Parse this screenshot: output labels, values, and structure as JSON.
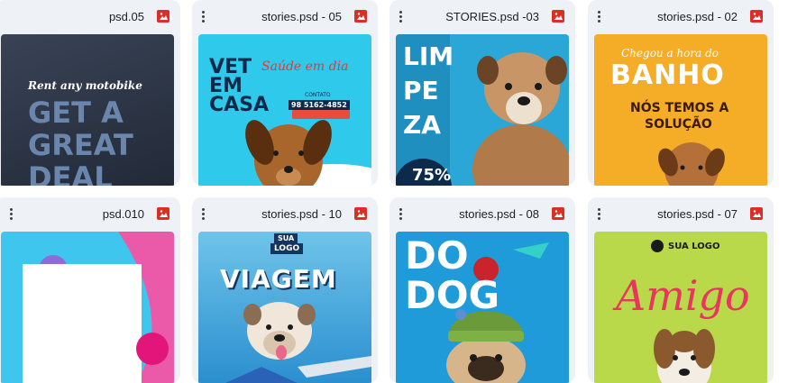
{
  "grid": {
    "rows": [
      [
        {
          "file_name": "psd.05",
          "thumb": {
            "line1": "Rent any motobike",
            "line2": "GET A",
            "line3": "GREAT",
            "line4": "DEAL"
          }
        },
        {
          "file_name": "stories.psd - 05",
          "thumb": {
            "line1": "VET",
            "line2": "EM",
            "line3": "CASA",
            "script": "Saúde em dia",
            "contact": "CONTATO",
            "phone": "98 5162-4852"
          }
        },
        {
          "file_name": "STORIES.psd -03",
          "thumb": {
            "line1": "LIM",
            "line2": "PE",
            "line3": "ZA",
            "badge": "75%"
          }
        },
        {
          "file_name": "stories.psd - 02",
          "thumb": {
            "script": "Chegou a hora do",
            "title": "BANHO",
            "line1": "NÓS TEMOS A",
            "line2": "SOLUÇÃO"
          }
        }
      ],
      [
        {
          "file_name": "psd.010",
          "thumb": {}
        },
        {
          "file_name": "stories.psd - 10",
          "thumb": {
            "logo_line1": "SUA",
            "logo_line2": "LOGO",
            "title": "VIAGEM"
          }
        },
        {
          "file_name": "stories.psd - 08",
          "thumb": {
            "line1": "DO",
            "line2": "DOG"
          }
        },
        {
          "file_name": "stories.psd - 07",
          "thumb": {
            "logo": "SUA LOGO",
            "script": "Amigo"
          }
        }
      ]
    ]
  },
  "icons": {
    "menu": "more-vert-icon",
    "file_type": "image-file-icon"
  },
  "colors": {
    "card_bg": "#eef1f6",
    "file_icon": "#d93025"
  }
}
